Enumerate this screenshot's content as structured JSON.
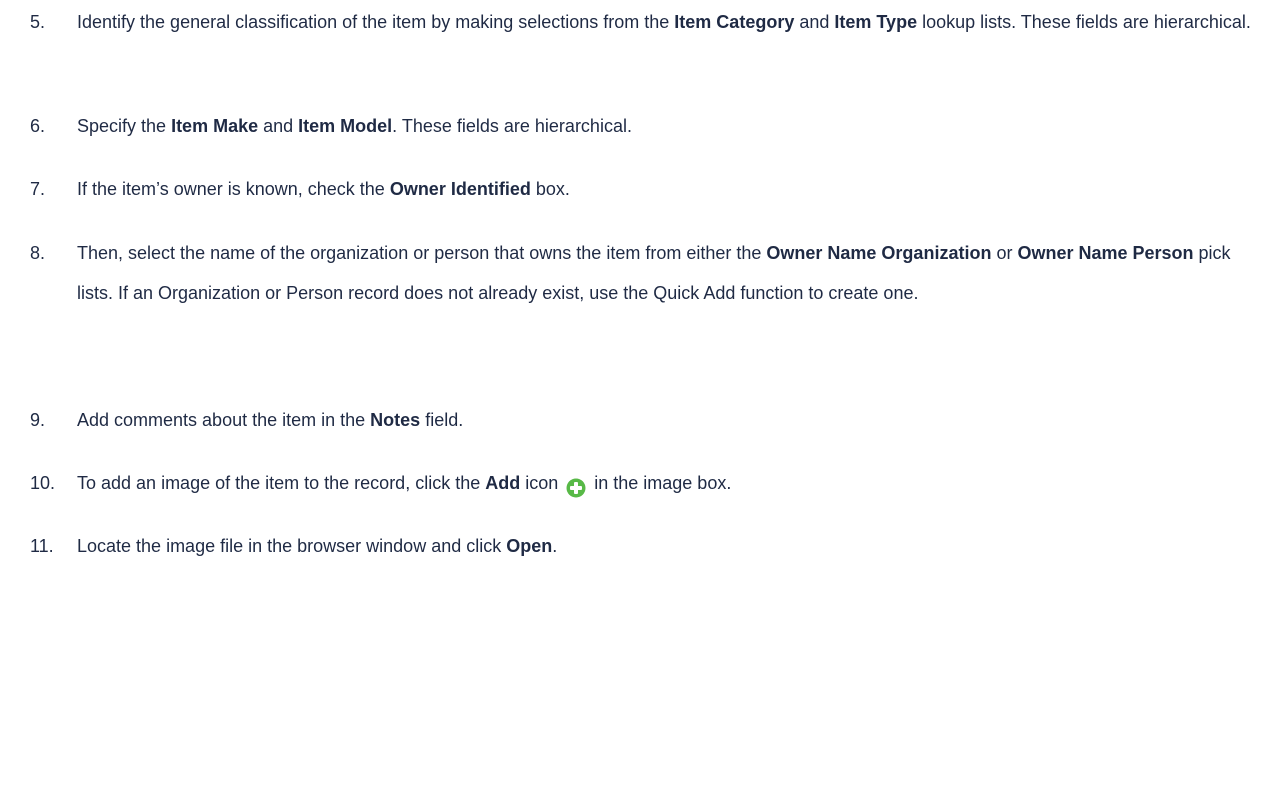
{
  "steps": [
    {
      "number": "5.",
      "parts": [
        {
          "t": "Identify the general classification of the item by making selections from the "
        },
        {
          "t": "Item Category",
          "b": true
        },
        {
          "t": " and "
        },
        {
          "t": "Item Type",
          "b": true
        },
        {
          "t": " lookup lists. These fields are hierarchical."
        }
      ]
    },
    {
      "number": "6.",
      "parts": [
        {
          "t": "Specify the "
        },
        {
          "t": "Item Make",
          "b": true
        },
        {
          "t": " and "
        },
        {
          "t": "Item Model",
          "b": true
        },
        {
          "t": ". These fields are hierarchical."
        }
      ]
    },
    {
      "number": "7.",
      "parts": [
        {
          "t": "If the item’s owner is known, check the "
        },
        {
          "t": "Owner Identified",
          "b": true
        },
        {
          "t": " box."
        }
      ]
    },
    {
      "number": "8.",
      "parts": [
        {
          "t": "Then, select the name of the organization or person that owns the item from either the "
        },
        {
          "t": "Owner Name Organization",
          "b": true
        },
        {
          "t": " or "
        },
        {
          "t": "Owner Name Person",
          "b": true
        },
        {
          "t": " pick lists. If an Organization or Person record does not already exist, use the Quick Add function to create one."
        }
      ]
    },
    {
      "number": "9.",
      "parts": [
        {
          "t": "Add comments about the item in the "
        },
        {
          "t": "Notes",
          "b": true
        },
        {
          "t": " field."
        }
      ]
    },
    {
      "number": "10.",
      "parts": [
        {
          "t": "To add an image of the item to the record, click the "
        },
        {
          "t": "Add",
          "b": true
        },
        {
          "t": " icon "
        },
        {
          "icon": "add-icon"
        },
        {
          "t": " in the image box."
        }
      ]
    },
    {
      "number": "11.",
      "parts": [
        {
          "t": "Locate the image file in the browser window and click "
        },
        {
          "t": "Open",
          "b": true
        },
        {
          "t": "."
        }
      ]
    }
  ],
  "colors": {
    "text": "#1f2a44",
    "add_icon_fill": "#58b947",
    "add_icon_symbol": "#ffffff"
  }
}
